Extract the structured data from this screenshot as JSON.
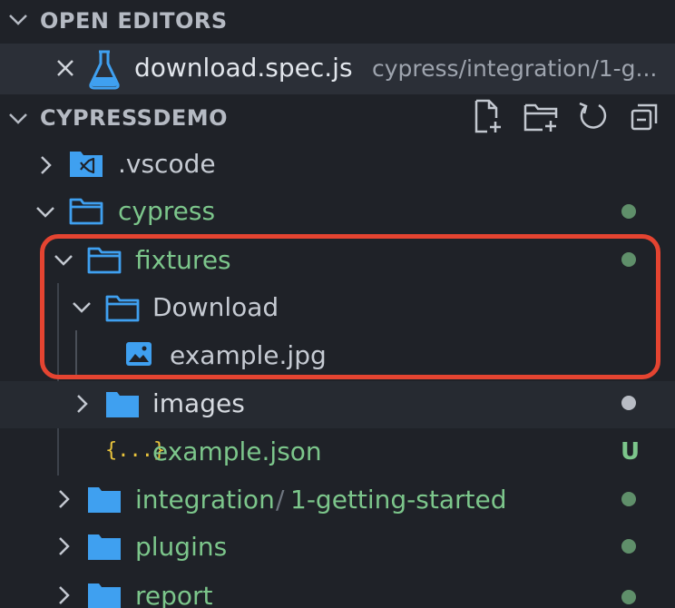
{
  "open_editors": {
    "title": "OPEN EDITORS",
    "items": [
      {
        "name": "download.spec.js",
        "path": "cypress/integration/1-g...",
        "icon": "flask-icon"
      }
    ]
  },
  "project": {
    "title": "CYPRESSDEMO",
    "toolbar": [
      "new-file-icon",
      "new-folder-icon",
      "refresh-icon",
      "collapse-all-icon"
    ]
  },
  "tree": {
    "vscode": ".vscode",
    "cypress": "cypress",
    "fixtures": "fixtures",
    "download": "Download",
    "example_jpg": "example.jpg",
    "images": "images",
    "example_json": "example.json",
    "example_json_icon": "{...}",
    "example_json_status": "U",
    "integration": "integration",
    "integration_sep": "/",
    "integration_sub": "1-getting-started",
    "plugins": "plugins",
    "report": "report"
  },
  "colors": {
    "background": "#1f2228",
    "modified_green": "#7cc68b",
    "folder_blue": "#3fa0f0",
    "highlight_red": "#e44431",
    "ignored_grey": "#b8bcc4"
  }
}
